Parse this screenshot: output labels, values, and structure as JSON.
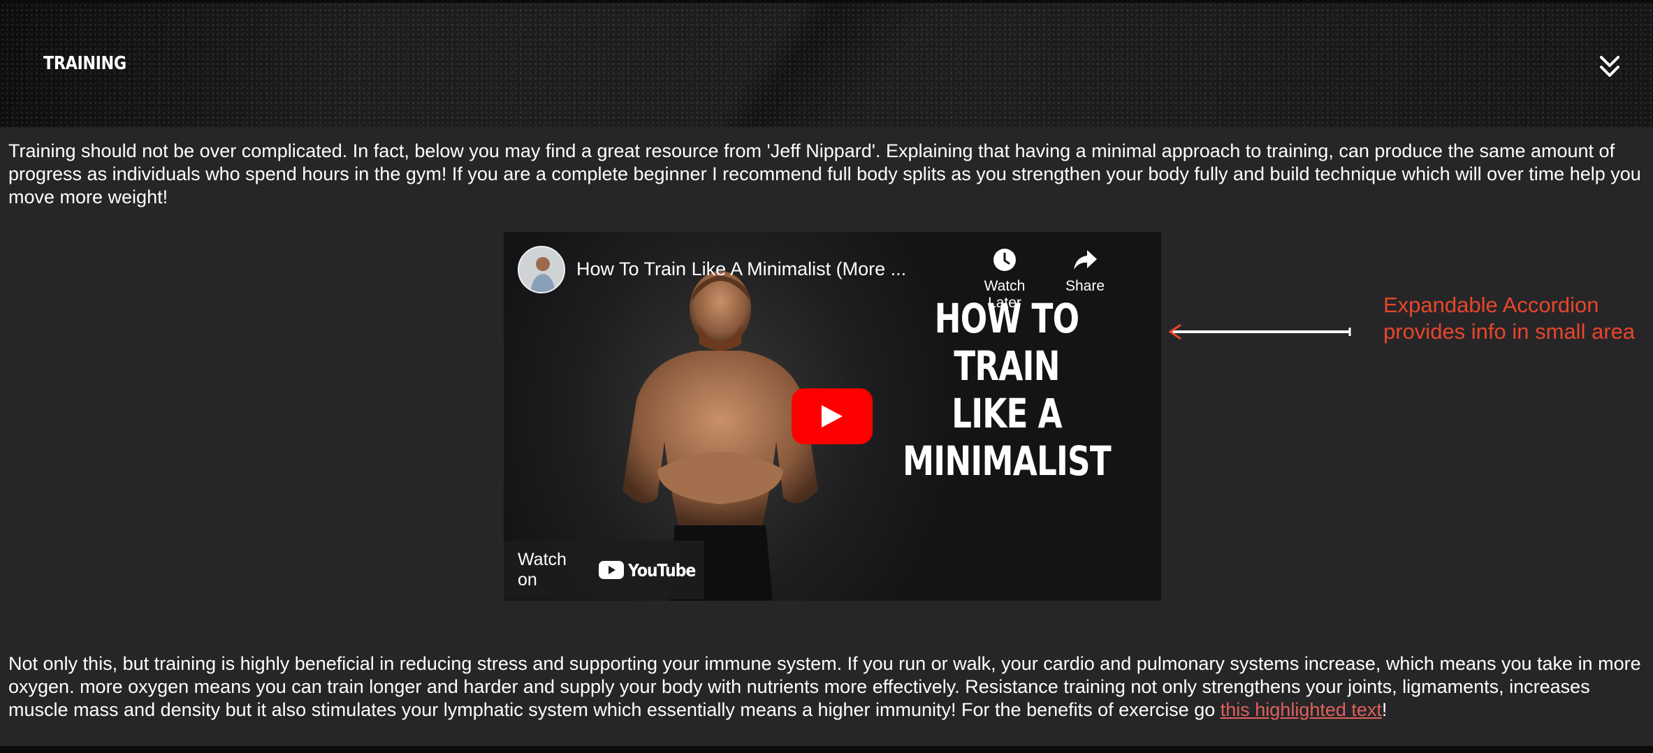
{
  "accordion": {
    "title": "TRAINING",
    "toggle_icon": "double-chevron-down-icon"
  },
  "intro_text": "Training should not be over complicated. In fact, below you may find a great resource from 'Jeff Nippard'. Explaining that having a minimal approach to training, can produce the same amount of progress as individuals who spend hours in the gym! If you are a complete beginner I recommend full body splits as you strengthen your body fully and build technique which will over time help you move more weight!",
  "video": {
    "title": "How To Train Like A Minimalist (More ...",
    "watch_later_label": "Watch Later",
    "share_label": "Share",
    "thumbnail_text": [
      "HOW TO TRAIN",
      "LIKE A",
      "MINIMALIST"
    ],
    "watch_on_label": "Watch on",
    "youtube_label": "YouTube",
    "play_color": "#ff0000"
  },
  "annotation": {
    "line1": "Expandable Accordion",
    "line2": "provides info in small area",
    "color": "#e8462b"
  },
  "body_text": {
    "before_link": "Not only this, but training is highly beneficial in reducing stress and supporting your immune system. If you run or walk, your cardio and pulmonary systems increase, which means you take in more oxygen. more oxygen means you can train longer and harder and supply your body with nutrients more effectively. Resistance training not only strengthens your joints, ligmaments, increases muscle mass and density but it also stimulates your lymphatic system which essentially means a higher immunity! For the benefits of exercise go ",
    "link_text": "this highlighted text",
    "after_link": "!",
    "link_color": "#e0605b"
  }
}
